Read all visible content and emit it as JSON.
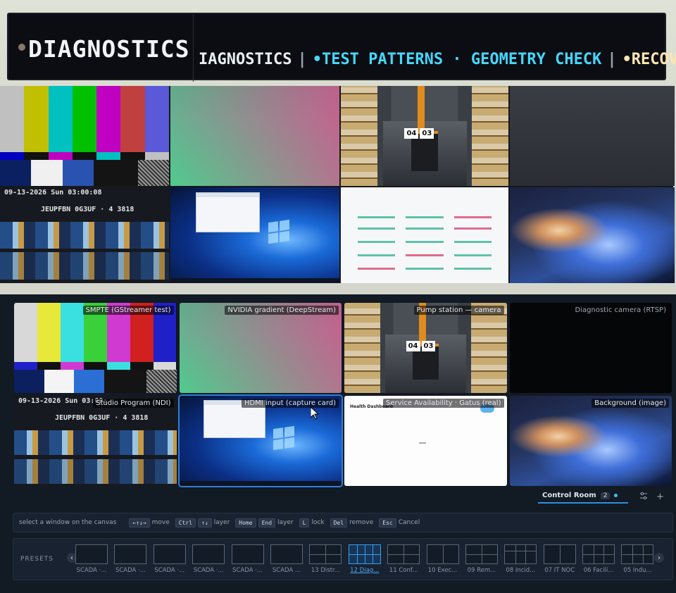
{
  "ticker": {
    "main": "DIAGNOSTICS",
    "crawl": [
      {
        "text": "IAGNOSTICS",
        "cls": "t1"
      },
      {
        "text": "•TEST PATTERNS",
        "cls": "t2"
      },
      {
        "text": "· GEOMETRY CHECK",
        "cls": "t3"
      },
      {
        "text": "•RECOV",
        "cls": "t4"
      }
    ],
    "separator": "|"
  },
  "wall_overlays": {
    "timestamp": "09-13-2026 Sun 03:00:08",
    "code": "JEUPFBN 0G3UF · 4 3818",
    "tag_a": "04",
    "tag_b": "03"
  },
  "canvas": {
    "tiles": [
      {
        "label": "SMPTE (GStreamer test)"
      },
      {
        "label": "NVIDIA gradient (DeepStream)"
      },
      {
        "label": "Pump station — camera"
      },
      {
        "label": "Diagnostic camera (RTSP)"
      },
      {
        "label": "Studio Program (NDI)",
        "timestamp": "09-13-2026 Sun 03:00:",
        "code": "JEUPFBN 0G3UF · 4 3818"
      },
      {
        "label": "HDMI input (capture card)"
      },
      {
        "label": "Service Availability · Gatus (real)",
        "heading": "Health Dashboard"
      },
      {
        "label": "Background (image)"
      }
    ]
  },
  "tabbar": {
    "active_tab": "Control Room",
    "count": "2",
    "settings_icon": "sliders-icon",
    "add_icon": "plus-icon"
  },
  "hints": {
    "prompt": "select a window on the canvas",
    "items": [
      {
        "keys": [
          "←↑↓→"
        ],
        "action": "move"
      },
      {
        "keys": [
          "Ctrl",
          "↑↓"
        ],
        "action": "layer"
      },
      {
        "keys": [
          "Home",
          "End"
        ],
        "action": "layer"
      },
      {
        "keys": [
          "L"
        ],
        "action": "lock"
      },
      {
        "keys": [
          "Del"
        ],
        "action": "remove"
      },
      {
        "keys": [
          "Esc"
        ],
        "action": "Cancel"
      }
    ]
  },
  "presets": {
    "label": "PRESETS",
    "items": [
      {
        "name": "SCADA ·...",
        "layout": "single"
      },
      {
        "name": "SCADA ·...",
        "layout": "single"
      },
      {
        "name": "SCADA ·...",
        "layout": "single"
      },
      {
        "name": "SCADA ·...",
        "layout": "single"
      },
      {
        "name": "SCADA ·...",
        "layout": "single"
      },
      {
        "name": "SCADA ...",
        "layout": "single"
      },
      {
        "name": "13 Distr...",
        "layout": "grid22"
      },
      {
        "name": "12 Diag...",
        "layout": "grid24",
        "active": true
      },
      {
        "name": "11 Conf...",
        "layout": "grid22"
      },
      {
        "name": "10 Exec...",
        "layout": "split"
      },
      {
        "name": "09 Rem...",
        "layout": "grid22"
      },
      {
        "name": "08 Incid...",
        "layout": "grid13"
      },
      {
        "name": "07 IT NOC",
        "layout": "cols2"
      },
      {
        "name": "06 Facili...",
        "layout": "grid23"
      },
      {
        "name": "05 Indu...",
        "layout": "grid23"
      }
    ]
  }
}
